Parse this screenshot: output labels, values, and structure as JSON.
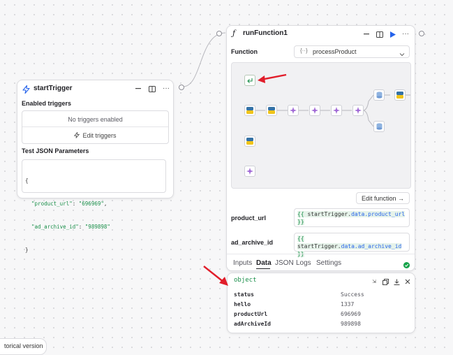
{
  "trigger": {
    "title": "startTrigger",
    "enabled_heading": "Enabled triggers",
    "no_triggers": "No triggers enabled",
    "edit_triggers": "Edit triggers",
    "test_heading": "Test JSON Parameters",
    "json_lines": [
      "{",
      "  \"product_url\": \"696969\",",
      "  \"ad_archive_id\": \"989898\"",
      "}"
    ]
  },
  "runfn": {
    "title": "runFunction1",
    "function_label": "Function",
    "function_value": "processProduct",
    "edit_function": "Edit function →",
    "params": [
      {
        "name": "product_url",
        "value_lines": [
          "{{ startTrigger.data.product_url",
          "}}"
        ]
      },
      {
        "name": "ad_archive_id",
        "value_lines": [
          "{{",
          "startTrigger.data.ad_archive_id }}"
        ]
      }
    ],
    "tabs": [
      "Inputs",
      "Data",
      "JSON",
      "Logs",
      "Settings"
    ],
    "active_tab": "Data"
  },
  "data_panel": {
    "type_label": "object",
    "rows": [
      {
        "key": "status",
        "value": "Success"
      },
      {
        "key": "hello",
        "value": "1337"
      },
      {
        "key": "productUrl",
        "value": "696969"
      },
      {
        "key": "adArchiveId",
        "value": "989898"
      }
    ]
  },
  "historical_version_label": "torical version",
  "colors": {
    "accent_blue": "#2563eb",
    "status_green": "#16a34a",
    "arrow_red": "#e11d2a",
    "code_green": "#1a8f4a"
  }
}
